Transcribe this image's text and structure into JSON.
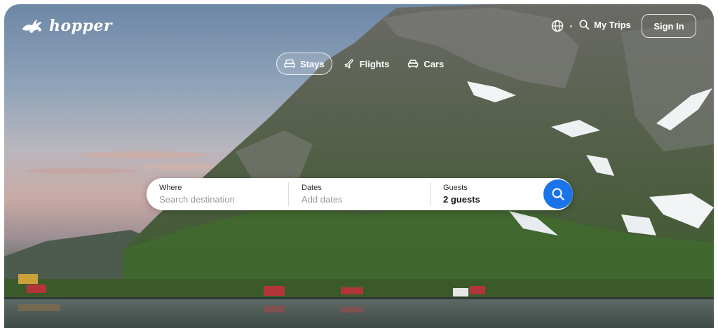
{
  "header": {
    "brand": "hopper",
    "my_trips": "My Trips",
    "sign_in": "Sign In"
  },
  "tabs": [
    {
      "label": "Stays",
      "icon": "bed-icon",
      "active": true
    },
    {
      "label": "Flights",
      "icon": "plane-icon",
      "active": false
    },
    {
      "label": "Cars",
      "icon": "car-icon",
      "active": false
    }
  ],
  "search": {
    "where_label": "Where",
    "where_placeholder": "Search destination",
    "dates_label": "Dates",
    "dates_placeholder": "Add dates",
    "guests_label": "Guests",
    "guests_value": "2 guests"
  },
  "colors": {
    "accent": "#1a73e8",
    "text_on_hero": "#ffffff"
  }
}
